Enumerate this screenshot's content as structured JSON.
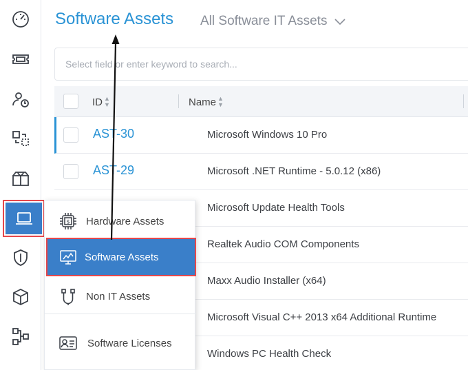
{
  "header": {
    "title": "Software Assets",
    "view_selector": "All Software IT Assets"
  },
  "search": {
    "placeholder": "Select field or enter keyword to search..."
  },
  "table": {
    "columns": [
      "ID",
      "Name"
    ],
    "rows": [
      {
        "id": "AST-30",
        "name": "Microsoft Windows 10 Pro"
      },
      {
        "id": "AST-29",
        "name": "Microsoft .NET Runtime - 5.0.12 (x86)"
      },
      {
        "id": "",
        "name": "Microsoft Update Health Tools"
      },
      {
        "id": "",
        "name": "Realtek Audio COM Components"
      },
      {
        "id": "",
        "name": "Maxx Audio Installer (x64)"
      },
      {
        "id": "",
        "name": "Microsoft Visual C++ 2013 x64 Additional Runtime"
      },
      {
        "id": "",
        "name": "Windows PC Health Check"
      }
    ]
  },
  "assets_menu": {
    "items": [
      {
        "label": "Hardware Assets",
        "icon": "hardware-chip-icon"
      },
      {
        "label": "Software Assets",
        "icon": "software-monitor-icon"
      },
      {
        "label": "Non IT Assets",
        "icon": "cable-plug-icon"
      },
      {
        "label": "Software Licenses",
        "icon": "license-card-icon"
      }
    ]
  },
  "sidebar": {
    "icons": [
      "dashboard-gauge-icon",
      "ticket-icon",
      "user-clock-icon",
      "change-flow-icon",
      "package-box-icon",
      "laptop-icon",
      "shield-icon",
      "cube-icon",
      "workflow-icon"
    ]
  },
  "colors": {
    "accent": "#2a93d5",
    "active_fill": "#3a7fc9",
    "highlight_border": "#e5474b"
  }
}
